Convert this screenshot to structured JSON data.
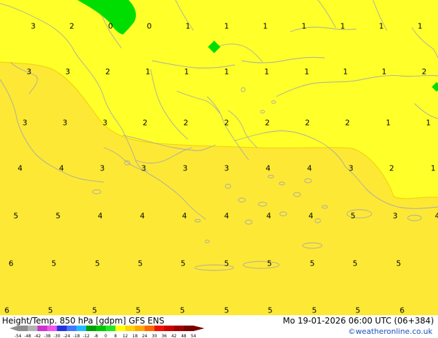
{
  "map": {
    "colors": {
      "zone_low": "#ffff2a",
      "zone_high": "#fde835",
      "coast": "#a9a9a9",
      "isoline": "#f2cf00",
      "green": "#00dd00"
    },
    "values": [
      [
        "3",
        "2",
        "0",
        "0",
        "1",
        "1",
        "1",
        "1",
        "1",
        "1",
        "1"
      ],
      [
        "3",
        "3",
        "2",
        "1",
        "1",
        "1",
        "1",
        "1",
        "1",
        "1",
        "2"
      ],
      [
        "3",
        "3",
        "3",
        "2",
        "2",
        "2",
        "2",
        "2",
        "2",
        "1",
        "1"
      ],
      [
        "4",
        "4",
        "3",
        "3",
        "3",
        "3",
        "4",
        "4",
        "3",
        "2",
        "1"
      ],
      [
        "5",
        "5",
        "4",
        "4",
        "4",
        "4",
        "4",
        "4",
        "5",
        "3",
        "4"
      ],
      [
        "6",
        "5",
        "5",
        "5",
        "5",
        "5",
        "5",
        "5",
        "5",
        "5"
      ],
      [
        "6",
        "5",
        "5",
        "5",
        "5",
        "5",
        "5",
        "5",
        "5",
        "6"
      ]
    ]
  },
  "footer": {
    "title_left": "Height/Temp. 850 hPa [gdpm] GFS ENS",
    "title_right": "Mo 19-01-2026 06:00 UTC (06+384)",
    "credit": "©weatheronline.co.uk",
    "colorbar_ticks": [
      "-54",
      "-48",
      "-42",
      "-38",
      "-30",
      "-24",
      "-18",
      "-12",
      "-8",
      "0",
      "8",
      "12",
      "18",
      "24",
      "30",
      "36",
      "42",
      "48",
      "54"
    ],
    "colorbar_colors": [
      "#8e8e8e",
      "#b3b3b3",
      "#cc33cc",
      "#ee55ee",
      "#2233dd",
      "#4477ff",
      "#22bbff",
      "#00a000",
      "#00c800",
      "#22e822",
      "#ffff00",
      "#ffd400",
      "#ffa800",
      "#ff6600",
      "#ee1100",
      "#cc0000",
      "#a00000",
      "#780000"
    ]
  }
}
